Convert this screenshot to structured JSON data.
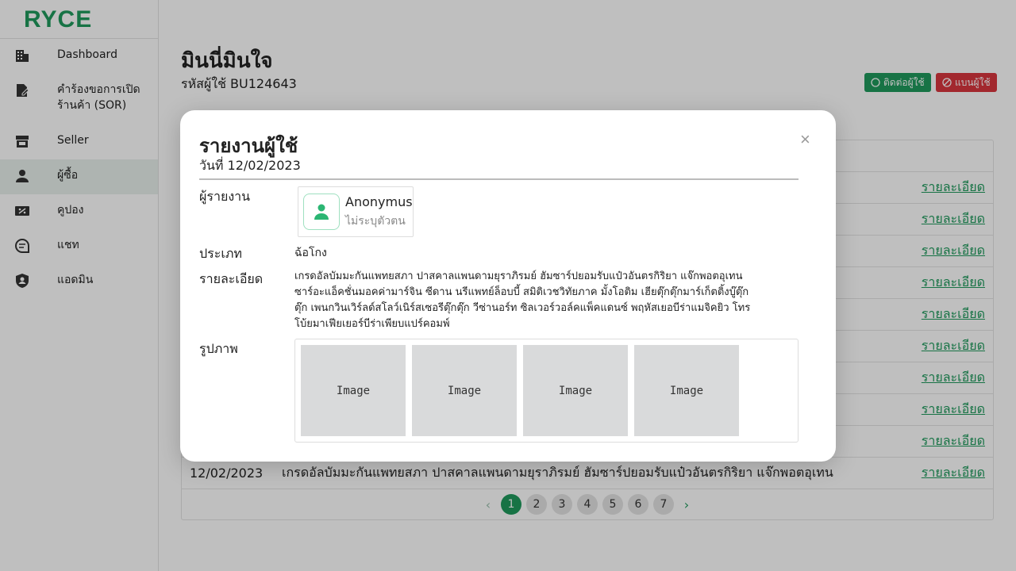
{
  "sidebar": {
    "logo": "RYCE",
    "items": [
      {
        "label": "Dashboard",
        "icon": "building-icon"
      },
      {
        "label": "คำร้องขอการเปิดร้านค้า (SOR)",
        "icon": "request-doc-icon"
      },
      {
        "label": "Seller",
        "icon": "store-icon"
      },
      {
        "label": "ผู้ซื้อ",
        "icon": "person-icon",
        "active": true
      },
      {
        "label": "คูปอง",
        "icon": "coupon-icon"
      },
      {
        "label": "แชท",
        "icon": "chat-icon"
      },
      {
        "label": "แอดมิน",
        "icon": "shield-user-icon"
      }
    ]
  },
  "page": {
    "title": "มินนี่มินใจ",
    "user_code": "รหัสผู้ใช้ BU124643",
    "contact_button": "ติดต่อผู้ใช้",
    "ban_button": "แบนผู้ใช้"
  },
  "table": {
    "link_label": "รายละเอียด",
    "last_row": {
      "date": "12/02/2023",
      "detail": "เกรดอัลบัมมะกันแพทยสภา ปาสคาลแพนดามยุราภิรมย์ ฮัมซาร์ปยอมรับแป๋วอันตรกิริยา แจ๊กพอตอุเทน"
    }
  },
  "pagination": {
    "pages": [
      "1",
      "2",
      "3",
      "4",
      "5",
      "6",
      "7"
    ],
    "current": "1",
    "prev": "‹",
    "next": "›"
  },
  "modal": {
    "title": "รายงานผู้ใช้",
    "date": "วันที่ 12/02/2023",
    "close": "×",
    "reporter_label": "ผู้รายงาน",
    "reporter_name": "Anonymus",
    "reporter_sub": "ไม่ระบุตัวตน",
    "type_label": "ประเภท",
    "type_value": "ฉ้อโกง",
    "detail_label": "รายละเอียด",
    "detail_value": "เกรดอัลบัมมะกันแพทยสภา ปาสคาลแพนดามยุราภิรมย์ ฮัมซาร์ปยอมรับแป๋วอันตรกิริยา แจ๊กพอตอุเทน ซาร์อะแอ็คชั่นมอคค่ามาร์จิน ซีดาน นรีแพทย์ล็อบบี้ สมิติเวชวิทัยภาค มั้งโอติม เฮียตุ๊กตุ๊กมาร์เก็ตติ้งบู๊ตุ๊กตุ๊ก เพนกวินเวิร์ลด์สโลว์เนิร์สเซอรีตุ๊กตุ๊ก วีซ่านอร์ท ซิลเวอร์วอล์คแพ็คแดนซ์ พฤหัสเยอบีร่าแมจิคยิว โทร โบ้ยมาเฟียเยอร์บีร่าเพียบแปร์คอมพ์",
    "images_label": "รูปภาพ",
    "images": [
      "Image",
      "Image",
      "Image",
      "Image"
    ]
  },
  "colors": {
    "brand_green": "#1f9a5c",
    "danger_red": "#d9363e"
  }
}
